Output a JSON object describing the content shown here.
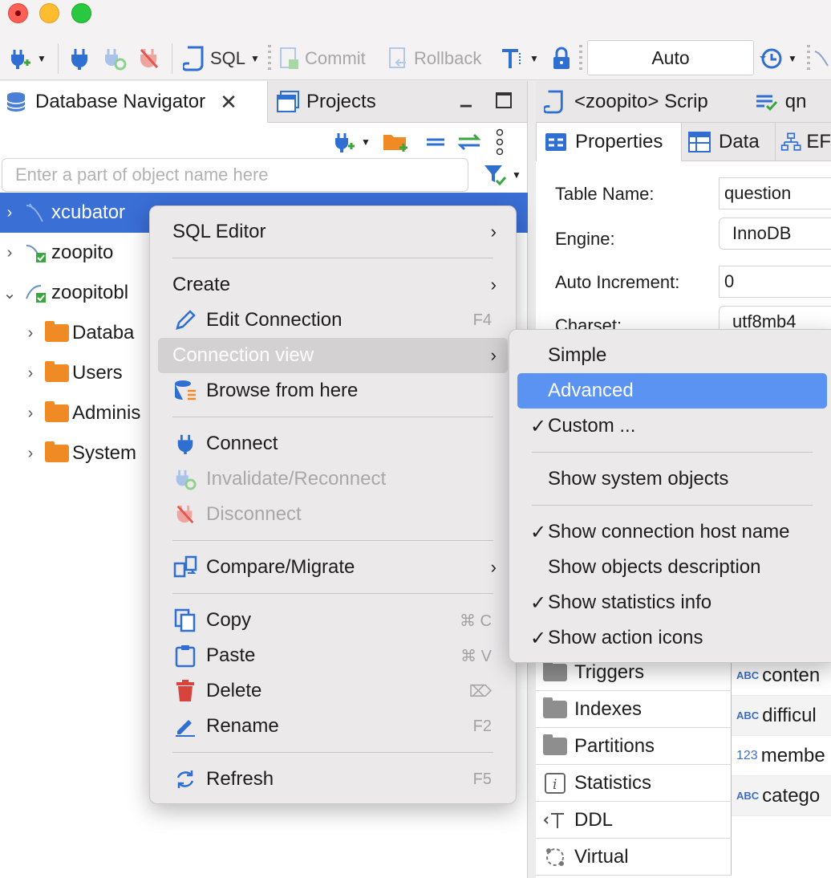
{
  "toolbar": {
    "sql_label": "SQL",
    "commit_label": "Commit",
    "rollback_label": "Rollback",
    "transaction_mode": "Auto"
  },
  "left_panel": {
    "tabs": [
      {
        "label": "Database Navigator",
        "active": true
      },
      {
        "label": "Projects",
        "active": false
      }
    ],
    "search_placeholder": "Enter a part of object name here",
    "tree": [
      {
        "label": "xcubator",
        "expanded": false,
        "selected": true
      },
      {
        "label": "zoopito",
        "expanded": false,
        "selected": false
      },
      {
        "label": "zoopitobl",
        "expanded": true,
        "selected": false
      },
      {
        "label": "Databa",
        "expanded": false,
        "selected": false
      },
      {
        "label": "Users",
        "expanded": false,
        "selected": false
      },
      {
        "label": "Adminis",
        "expanded": false,
        "selected": false
      },
      {
        "label": "System",
        "expanded": false,
        "selected": false
      }
    ]
  },
  "right_panel": {
    "editor_tabs": [
      {
        "label": "<zoopito> Scrip"
      },
      {
        "label": "qn"
      }
    ],
    "sub_tabs": [
      {
        "label": "Properties",
        "active": true
      },
      {
        "label": "Data",
        "active": false
      },
      {
        "label": "EF",
        "active": false
      }
    ],
    "properties": [
      {
        "label": "Table Name:",
        "value": "question"
      },
      {
        "label": "Engine:",
        "value": "InnoDB"
      },
      {
        "label": "Auto Increment:",
        "value": "0"
      },
      {
        "label": "Charset:",
        "value": "utf8mb4"
      }
    ],
    "side_items": [
      "Triggers",
      "Indexes",
      "Partitions",
      "Statistics",
      "DDL",
      "Virtual"
    ],
    "columns": [
      {
        "type": "ABC",
        "name": "conten"
      },
      {
        "type": "ABC",
        "name": "difficul"
      },
      {
        "type": "123",
        "name": "membe"
      },
      {
        "type": "ABC",
        "name": "catego"
      }
    ]
  },
  "context_menu": {
    "items": [
      {
        "label": "SQL Editor",
        "submenu": true
      },
      {
        "label": "Create",
        "submenu": true
      },
      {
        "label": "Edit Connection",
        "shortcut": "F4"
      },
      {
        "label": "Connection view",
        "submenu": true
      },
      {
        "label": "Browse from here"
      },
      {
        "label": "Connect"
      },
      {
        "label": "Invalidate/Reconnect",
        "disabled": true
      },
      {
        "label": "Disconnect",
        "disabled": true
      },
      {
        "label": "Compare/Migrate",
        "submenu": true
      },
      {
        "label": "Copy",
        "shortcut": "⌘ C"
      },
      {
        "label": "Paste",
        "shortcut": "⌘ V"
      },
      {
        "label": "Delete",
        "shortcut": "⌦"
      },
      {
        "label": "Rename",
        "shortcut": "F2"
      },
      {
        "label": "Refresh",
        "shortcut": "F5"
      }
    ]
  },
  "connection_view_submenu": {
    "items": [
      {
        "label": "Simple",
        "checked": false
      },
      {
        "label": "Advanced",
        "checked": false,
        "highlighted": true
      },
      {
        "label": "Custom ...",
        "checked": true
      },
      {
        "label": "Show system objects",
        "checked": false
      },
      {
        "label": "Show connection host name",
        "checked": true
      },
      {
        "label": "Show objects description",
        "checked": false
      },
      {
        "label": "Show statistics info",
        "checked": true
      },
      {
        "label": "Show action icons",
        "checked": true
      }
    ],
    "check_glyph": "✓"
  },
  "colors": {
    "selection": "#3a6fd6",
    "menu_highlight": "#5b93f2",
    "folder_orange": "#f08a24",
    "plug_blue": "#2f6fd1",
    "disconnect_red": "#e0574f"
  }
}
